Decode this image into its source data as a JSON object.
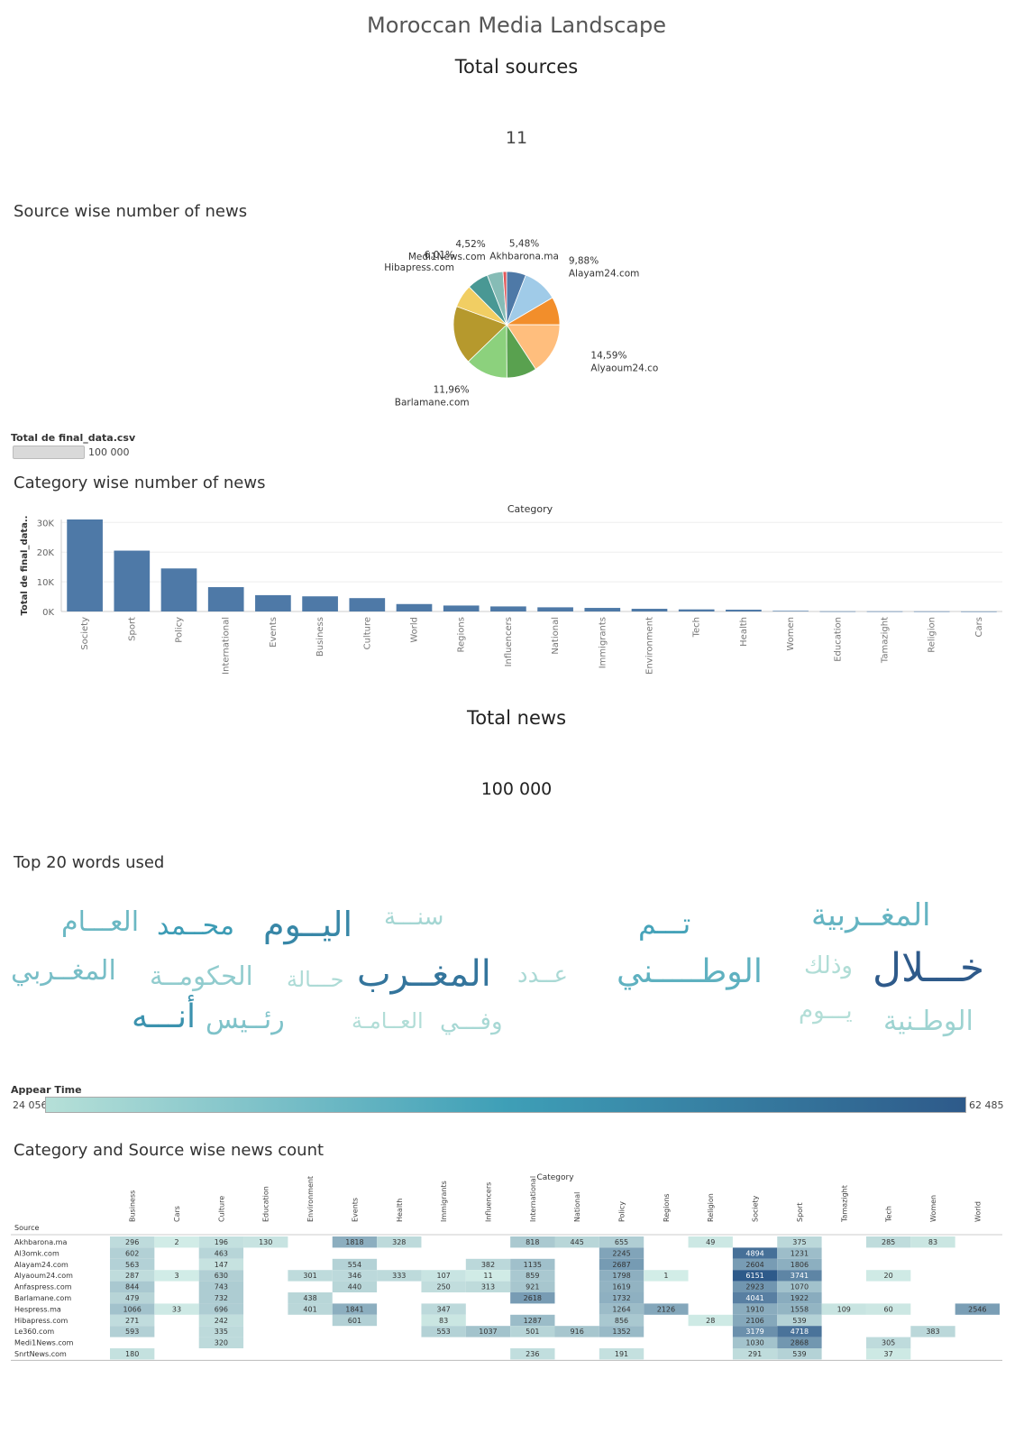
{
  "dashboard": {
    "title": "Moroccan Media Landscape",
    "kpi_sources_title": "Total sources",
    "kpi_sources_value": "11",
    "kpi_news_title": "Total news",
    "kpi_news_value": "100 000",
    "sections": {
      "pie": "Source wise number of news",
      "bar": "Category wise number of news",
      "words": "Top 20 words used",
      "heatmap": "Category and Source wise news count"
    },
    "pie_legend": {
      "title": "Total de final_data.csv",
      "value": "100 000"
    },
    "word_legend": {
      "title": "Appear Time",
      "min": "24 056",
      "max": "62 485"
    }
  },
  "chart_data": [
    {
      "type": "pie",
      "title": "Source wise number of news",
      "slices": [
        {
          "label": "Akhbarona.ma",
          "pct": 5.48,
          "pct_label": "5,48%",
          "color": "#4e79a7"
        },
        {
          "label": "Alayam24.com",
          "pct": 9.88,
          "pct_label": "9,88%",
          "color": "#a0cbe8"
        },
        {
          "label": "Al3omk.com",
          "pct": 7.9,
          "pct_label": "",
          "color": "#f28e2b"
        },
        {
          "label": "Alyaoum24.com",
          "pct": 14.59,
          "pct_label": "14,59%",
          "color": "#ffbe7d"
        },
        {
          "label": "Anfaspress.com",
          "pct": 8.5,
          "pct_label": "",
          "color": "#59a14f"
        },
        {
          "label": "Barlamane.com",
          "pct": 11.96,
          "pct_label": "11,96%",
          "color": "#8cd17d"
        },
        {
          "label": "Hespress.ma",
          "pct": 16.5,
          "pct_label": "",
          "color": "#b6992d"
        },
        {
          "label": "Le360.com",
          "pct": 6.5,
          "pct_label": "",
          "color": "#f1ce63"
        },
        {
          "label": "Hibapress.com",
          "pct": 6.01,
          "pct_label": "6,01%",
          "color": "#499894"
        },
        {
          "label": "Medi1News.com",
          "pct": 4.52,
          "pct_label": "4,52%",
          "color": "#86bcb6"
        },
        {
          "label": "SnrtNews.com",
          "pct": 1.0,
          "pct_label": "",
          "color": "#e15759"
        }
      ]
    },
    {
      "type": "bar",
      "title": "Category",
      "ylabel": "Total de final_data..",
      "ylim": [
        0,
        31000
      ],
      "yticks": [
        0,
        10000,
        20000,
        30000
      ],
      "ytick_labels": [
        "0K",
        "10K",
        "20K",
        "30K"
      ],
      "color": "#4e79a7",
      "categories": [
        "Society",
        "Sport",
        "Policy",
        "International",
        "Events",
        "Business",
        "Culture",
        "World",
        "Regions",
        "Influencers",
        "National",
        "Immigrants",
        "Environment",
        "Tech",
        "Health",
        "Women",
        "Education",
        "Tamazight",
        "Religion",
        "Cars"
      ],
      "values": [
        31000,
        20500,
        14500,
        8200,
        5500,
        5100,
        4500,
        2500,
        2000,
        1700,
        1400,
        1200,
        900,
        700,
        600,
        200,
        60,
        50,
        40,
        20
      ]
    },
    {
      "type": "wordcloud",
      "words": [
        {
          "text": "خـــلال",
          "value": 62485
        },
        {
          "text": "المغــرب",
          "value": 55000
        },
        {
          "text": "اليــوم",
          "value": 50000
        },
        {
          "text": "أنـــه",
          "value": 47000
        },
        {
          "text": "الوطـــــني",
          "value": 38000
        },
        {
          "text": "المغــربية",
          "value": 37000
        },
        {
          "text": "محــمد",
          "value": 44000
        },
        {
          "text": "العـــام",
          "value": 36000
        },
        {
          "text": "المغــربي",
          "value": 34000
        },
        {
          "text": "تـــم",
          "value": 42000
        },
        {
          "text": "رئــيس",
          "value": 33000
        },
        {
          "text": "الحكومــة",
          "value": 30000
        },
        {
          "text": "سنـــة",
          "value": 27000
        },
        {
          "text": "حـــالة",
          "value": 25500
        },
        {
          "text": "عــدد",
          "value": 26000
        },
        {
          "text": "وذلك",
          "value": 25000
        },
        {
          "text": "الوطـنية",
          "value": 28000
        },
        {
          "text": "يـــوم",
          "value": 24500
        },
        {
          "text": "العــامـة",
          "value": 24800
        },
        {
          "text": "وفـــي",
          "value": 26500
        }
      ]
    },
    {
      "type": "heatmap",
      "title": "Category",
      "row_header": "Source",
      "columns": [
        "Business",
        "Cars",
        "Culture",
        "Education",
        "Environment",
        "Events",
        "Health",
        "Immigrants",
        "Influencers",
        "International",
        "National",
        "Policy",
        "Regions",
        "Religion",
        "Society",
        "Sport",
        "Tamazight",
        "Tech",
        "Women",
        "World"
      ],
      "rows": [
        "Akhbarona.ma",
        "Al3omk.com",
        "Alayam24.com",
        "Alyaoum24.com",
        "Anfaspress.com",
        "Barlamane.com",
        "Hespress.ma",
        "Hibapress.com",
        "Le360.com",
        "Medi1News.com",
        "SnrtNews.com"
      ],
      "values": [
        [
          296,
          2,
          196,
          130,
          null,
          1818,
          328,
          null,
          null,
          818,
          445,
          655,
          null,
          49,
          null,
          375,
          null,
          285,
          83,
          null
        ],
        [
          602,
          null,
          463,
          null,
          null,
          null,
          null,
          null,
          null,
          null,
          null,
          2245,
          null,
          null,
          4894,
          1231,
          null,
          null,
          null,
          null
        ],
        [
          563,
          null,
          147,
          null,
          null,
          554,
          null,
          null,
          382,
          1135,
          null,
          2687,
          null,
          null,
          2604,
          1806,
          null,
          null,
          null,
          null
        ],
        [
          287,
          3,
          630,
          null,
          301,
          346,
          333,
          107,
          11,
          859,
          null,
          1798,
          1,
          null,
          6151,
          3741,
          null,
          20,
          null,
          null
        ],
        [
          844,
          null,
          743,
          null,
          null,
          440,
          null,
          250,
          313,
          921,
          null,
          1619,
          null,
          null,
          2923,
          1070,
          null,
          null,
          null,
          null
        ],
        [
          479,
          null,
          732,
          null,
          438,
          null,
          null,
          null,
          null,
          2618,
          null,
          1732,
          null,
          null,
          4041,
          1922,
          null,
          null,
          null,
          null
        ],
        [
          1066,
          33,
          696,
          null,
          401,
          1841,
          null,
          347,
          null,
          null,
          null,
          1264,
          2126,
          null,
          1910,
          1558,
          109,
          60,
          null,
          2546
        ],
        [
          271,
          null,
          242,
          null,
          null,
          601,
          null,
          83,
          null,
          1287,
          null,
          856,
          null,
          28,
          2106,
          539,
          null,
          null,
          null,
          null
        ],
        [
          593,
          null,
          335,
          null,
          null,
          null,
          null,
          553,
          1037,
          501,
          916,
          1352,
          null,
          null,
          3179,
          4718,
          null,
          null,
          383,
          null
        ],
        [
          null,
          null,
          320,
          null,
          null,
          null,
          null,
          null,
          null,
          null,
          null,
          null,
          null,
          null,
          1030,
          2868,
          null,
          305,
          null,
          null
        ],
        [
          180,
          null,
          null,
          null,
          null,
          null,
          null,
          null,
          null,
          236,
          null,
          191,
          null,
          null,
          291,
          539,
          null,
          37,
          null,
          null
        ]
      ],
      "color_low": "#d2ede7",
      "color_high": "#2e5a8a"
    }
  ]
}
